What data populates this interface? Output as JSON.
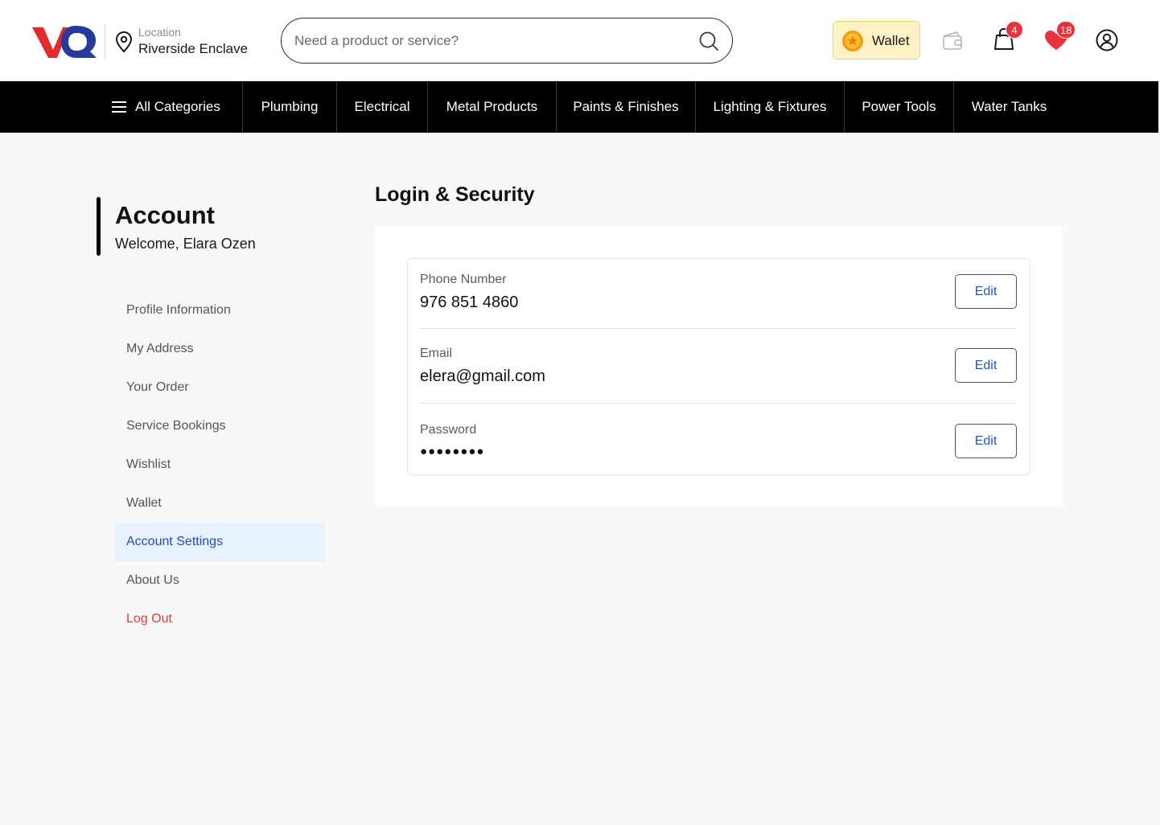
{
  "header": {
    "logo_text": "VQ",
    "location_caption": "Location",
    "location_value": "Riverside Enclave",
    "search_placeholder": "Need a product or service?",
    "wallet_label": "Wallet",
    "cart_count": "4",
    "wishlist_count": "18",
    "icons": [
      "map-pin-icon",
      "search-icon",
      "coin-icon",
      "wallet-icon",
      "shopping-bag-icon",
      "heart-icon",
      "user-icon"
    ]
  },
  "nav": {
    "all_categories": "All Categories",
    "items": [
      "Plumbing",
      "Electrical",
      "Metal Products",
      "Paints & Finishes",
      "Lighting & Fixtures",
      "Power Tools",
      "Water Tanks"
    ]
  },
  "sidebar": {
    "title": "Account",
    "welcome": "Welcome, Elara Ozen",
    "items": [
      {
        "label": "Profile Information"
      },
      {
        "label": "My Address"
      },
      {
        "label": "Your Order"
      },
      {
        "label": "Service Bookings"
      },
      {
        "label": "Wishlist"
      },
      {
        "label": "Wallet"
      },
      {
        "label": "Account Settings",
        "active": true
      },
      {
        "label": "About Us"
      },
      {
        "label": "Log Out"
      }
    ]
  },
  "main": {
    "title": "Login & Security",
    "fields": [
      {
        "label": "Phone Number",
        "value": "976 851 4860",
        "action": "Edit"
      },
      {
        "label": "Email",
        "value": "elera@gmail.com",
        "action": "Edit"
      },
      {
        "label": "Password",
        "value": "●●●●●●●●",
        "action": "Edit"
      }
    ]
  },
  "colors": {
    "accent_blue": "#1f56c4",
    "brand_red": "#e5373a",
    "active_bg": "#e7f1ff",
    "nav_bg": "#000000",
    "wallet_bg": "#fdf3c6"
  }
}
